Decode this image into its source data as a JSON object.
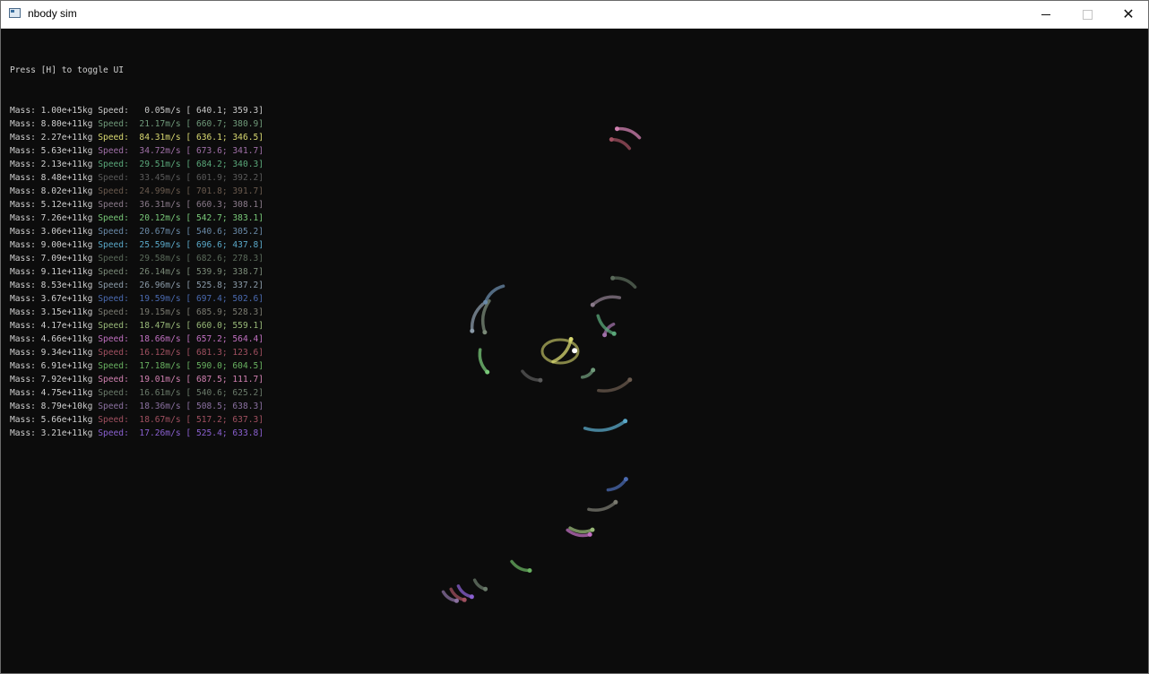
{
  "window": {
    "title": "nbody sim",
    "icon": "app-window-icon",
    "controls": {
      "minimize": "minimize-icon",
      "maximize": "maximize-icon",
      "close": "close-icon"
    }
  },
  "ui": {
    "hint": "Press [H] to toggle UI",
    "mass_label": "Mass:",
    "speed_label": "Speed:",
    "bodies": [
      {
        "mass": "1.00e+15kg",
        "speed": "  0.05m/s",
        "x": "640.1",
        "y": "359.3",
        "color": "#c8c8c8"
      },
      {
        "mass": "8.80e+11kg",
        "speed": " 21.17m/s",
        "x": "660.7",
        "y": "380.9",
        "color": "#6f9a7a"
      },
      {
        "mass": "2.27e+11kg",
        "speed": " 84.31m/s",
        "x": "636.1",
        "y": "346.5",
        "color": "#d8d870"
      },
      {
        "mass": "5.63e+11kg",
        "speed": " 34.72m/s",
        "x": "673.6",
        "y": "341.7",
        "color": "#a070a8"
      },
      {
        "mass": "2.13e+11kg",
        "speed": " 29.51m/s",
        "x": "684.2",
        "y": "340.3",
        "color": "#5aa87a"
      },
      {
        "mass": "8.48e+11kg",
        "speed": " 33.45m/s",
        "x": "601.9",
        "y": "392.2",
        "color": "#5a5a5a"
      },
      {
        "mass": "8.02e+11kg",
        "speed": " 24.99m/s",
        "x": "701.8",
        "y": "391.7",
        "color": "#6a5a4e"
      },
      {
        "mass": "5.12e+11kg",
        "speed": " 36.31m/s",
        "x": "660.3",
        "y": "308.1",
        "color": "#8a7a8a"
      },
      {
        "mass": "7.26e+11kg",
        "speed": " 20.12m/s",
        "x": "542.7",
        "y": "383.1",
        "color": "#78c878"
      },
      {
        "mass": "3.06e+11kg",
        "speed": " 20.67m/s",
        "x": "540.6",
        "y": "305.2",
        "color": "#6a8aa8"
      },
      {
        "mass": "9.00e+11kg",
        "speed": " 25.59m/s",
        "x": "696.6",
        "y": "437.8",
        "color": "#5aa8c8"
      },
      {
        "mass": "7.09e+11kg",
        "speed": " 29.58m/s",
        "x": "682.6",
        "y": "278.3",
        "color": "#5a6a5a"
      },
      {
        "mass": "9.11e+11kg",
        "speed": " 26.14m/s",
        "x": "539.9",
        "y": "338.7",
        "color": "#7a8a78"
      },
      {
        "mass": "8.53e+11kg",
        "speed": " 26.96m/s",
        "x": "525.8",
        "y": "337.2",
        "color": "#8a9aa8"
      },
      {
        "mass": "3.67e+11kg",
        "speed": " 19.59m/s",
        "x": "697.4",
        "y": "502.6",
        "color": "#4a6ab0"
      },
      {
        "mass": "3.15e+11kg",
        "speed": " 19.15m/s",
        "x": "685.9",
        "y": "528.3",
        "color": "#7a7a70"
      },
      {
        "mass": "4.17e+11kg",
        "speed": " 18.47m/s",
        "x": "660.0",
        "y": "559.1",
        "color": "#98b878"
      },
      {
        "mass": "4.66e+11kg",
        "speed": " 18.66m/s",
        "x": "657.2",
        "y": "564.4",
        "color": "#c070c0"
      },
      {
        "mass": "9.34e+11kg",
        "speed": " 16.12m/s",
        "x": "681.3",
        "y": "123.6",
        "color": "#a05060"
      },
      {
        "mass": "6.91e+11kg",
        "speed": " 17.18m/s",
        "x": "590.0",
        "y": "604.5",
        "color": "#68b060"
      },
      {
        "mass": "7.92e+11kg",
        "speed": " 19.01m/s",
        "x": "687.5",
        "y": "111.7",
        "color": "#d080b0"
      },
      {
        "mass": "4.75e+11kg",
        "speed": " 16.61m/s",
        "x": "540.6",
        "y": "625.2",
        "color": "#6a7a6a"
      },
      {
        "mass": "8.79e+10kg",
        "speed": " 18.36m/s",
        "x": "508.5",
        "y": "638.3",
        "color": "#8a70a0"
      },
      {
        "mass": "5.66e+11kg",
        "speed": " 18.67m/s",
        "x": "517.2",
        "y": "637.3",
        "color": "#a05060"
      },
      {
        "mass": "3.21e+11kg",
        "speed": " 17.26m/s",
        "x": "525.4",
        "y": "633.8",
        "color": "#8a60d0"
      }
    ]
  }
}
